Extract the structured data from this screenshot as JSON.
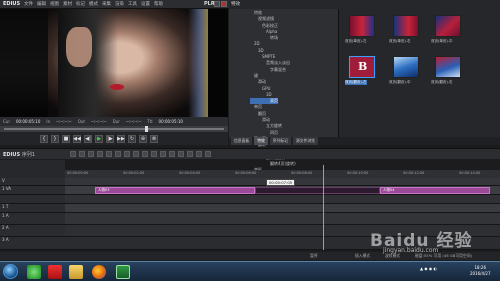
{
  "app": {
    "title": "EDIUS",
    "menu": [
      "文件",
      "编辑",
      "视图",
      "素材",
      "标记",
      "模式",
      "采集",
      "渲染",
      "工具",
      "设置",
      "帮助"
    ],
    "plr": "PLR"
  },
  "preview": {
    "tc_label_cur": "Cur",
    "tc_cur": "00:00:05:10",
    "tc_label_in": "In",
    "tc_in": "--:--:--:--",
    "tc_label_out": "Out",
    "tc_out": "--:--:--:--",
    "tc_label_dur": "Dur",
    "tc_dur": "--:--:--:--",
    "tc_label_ttl": "Ttl",
    "tc_ttl": "00:00:05:10"
  },
  "effects": {
    "title": "特效",
    "tree": [
      "特效",
      "视频滤镜",
      "色彩校正",
      "Alpha",
      "转场",
      "2D",
      "3D",
      "SMPTE",
      "音频淡入淡出",
      "字幕混合",
      "键",
      "滑动",
      "GPU",
      "3D",
      "双页",
      "单页",
      "翻页",
      "滑动",
      "立方旋转",
      "四页",
      "百叶窗",
      "翻转",
      "翻转(滚动)",
      "翻转(翻页)",
      "翻转4页(旋转)",
      "变形",
      "爆炸",
      "漩涡",
      "3D 溶化",
      "平面"
    ],
    "selected_index": 14,
    "thumbs": [
      {
        "label": "双页(单页)-左"
      },
      {
        "label": "双页(单页)-右"
      },
      {
        "label": "双页(单页)-中"
      },
      {
        "label": "双页(翻页)-左"
      },
      {
        "label": "双页(翻页)-中"
      },
      {
        "label": "双页(翻页)-右"
      }
    ],
    "tabs": [
      "信息面板",
      "特效",
      "序列标记",
      "源文件浏览"
    ]
  },
  "timeline": {
    "title": "EDIUS",
    "sequence": "序列1",
    "ruler": [
      "00:00:00:00",
      "00:00:02:00",
      "00:00:04:00",
      "00:00:06:00",
      "00:00:08:00",
      "00:00:10:00",
      "00:00:12:00",
      "00:00:14:00"
    ],
    "tc_popup": "00:00:07:05",
    "tracks": [
      {
        "name": "V",
        "kind": "video"
      },
      {
        "name": "1 VA",
        "kind": "va"
      },
      {
        "name": "",
        "kind": "blank"
      },
      {
        "name": "1 T",
        "kind": "title"
      },
      {
        "name": "1 A",
        "kind": "audio"
      },
      {
        "name": "2 A",
        "kind": "audio"
      },
      {
        "name": "3 A",
        "kind": "audio"
      }
    ],
    "clips": [
      {
        "label": "人物03"
      },
      {
        "label": "人物04"
      }
    ],
    "status": [
      "暂停",
      "插入模式",
      "波纹模式",
      "磁盘:55% 可用 (46 GB可用空间)"
    ]
  },
  "taskbar": {
    "time": "18:26",
    "date": "2016/4/27"
  },
  "watermark": {
    "brand": "Baidu 经验",
    "url": "jingyan.baidu.com"
  },
  "colors": {
    "clip": "#9b4a97",
    "playhead": "#41c3d6",
    "selection": "#3d6fb5"
  }
}
